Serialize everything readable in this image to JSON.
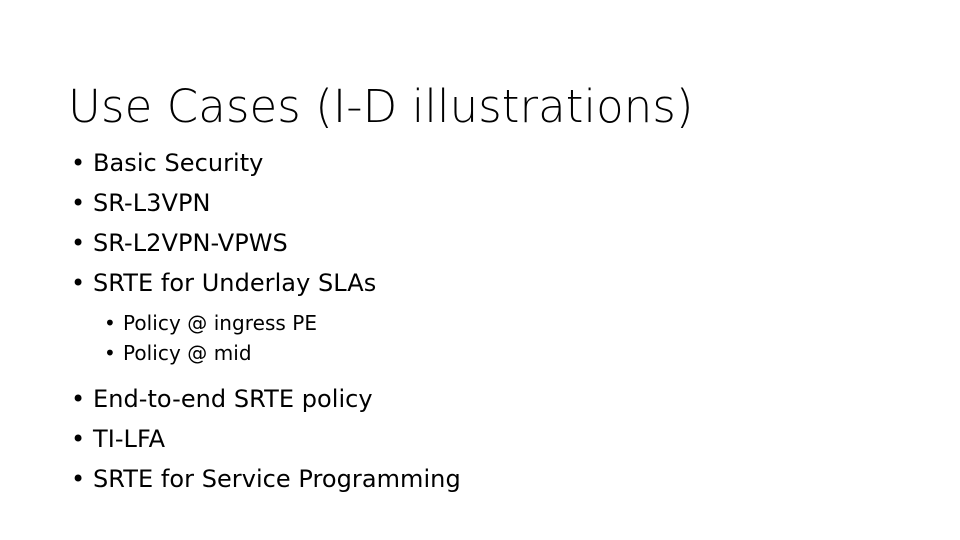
{
  "slide": {
    "title": "Use Cases (I-D illustrations)",
    "background_color": "#ffffff",
    "text_color": "#000000",
    "bullet_glyph": "•",
    "bullets": [
      {
        "level": 1,
        "label": "Basic Security"
      },
      {
        "level": 1,
        "label": "SR-L3VPN"
      },
      {
        "level": 1,
        "label": "SR-L2VPN-VPWS"
      },
      {
        "level": 1,
        "label": "SRTE for Underlay SLAs"
      },
      {
        "level": 2,
        "label": "Policy @ ingress PE"
      },
      {
        "level": 2,
        "label": "Policy @ mid"
      },
      {
        "level": 1,
        "label": "End-to-end SRTE policy"
      },
      {
        "level": 1,
        "label": "TI-LFA"
      },
      {
        "level": 1,
        "label": "SRTE for Service Programming"
      }
    ]
  }
}
